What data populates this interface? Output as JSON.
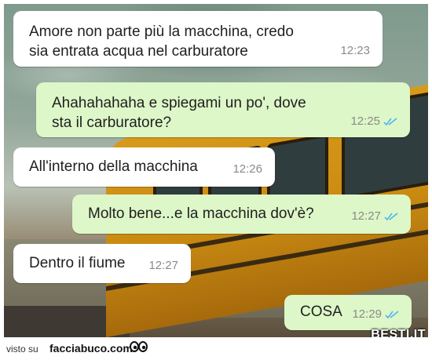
{
  "chat": {
    "messages": [
      {
        "text": "Amore non parte più la macchina, credo\nsia entrata acqua nel carburatore",
        "time": "12:23",
        "direction": "in"
      },
      {
        "text": "Ahahahahaha e spiegami un po', dove\nsta il carburatore?",
        "time": "12:25",
        "direction": "out",
        "read": true
      },
      {
        "text": "All'interno della macchina",
        "time": "12:26",
        "direction": "in"
      },
      {
        "text": "Molto bene...e la macchina dov'è?",
        "time": "12:27",
        "direction": "out",
        "read": true
      },
      {
        "text": "Dentro il fiume",
        "time": "12:27",
        "direction": "in"
      },
      {
        "text": "COSA",
        "time": "12:29",
        "direction": "out",
        "read": true
      }
    ]
  },
  "footer": {
    "visto_label": "visto su",
    "site_name": "facciabuco.com",
    "logo_icon": "eyes-icon"
  },
  "watermark": "BESTI.IT",
  "colors": {
    "incoming_bubble": "#ffffff",
    "outgoing_bubble": "#ddf7c8",
    "read_ticks": "#4fb6ec",
    "timestamp": "#8a8a8a"
  }
}
